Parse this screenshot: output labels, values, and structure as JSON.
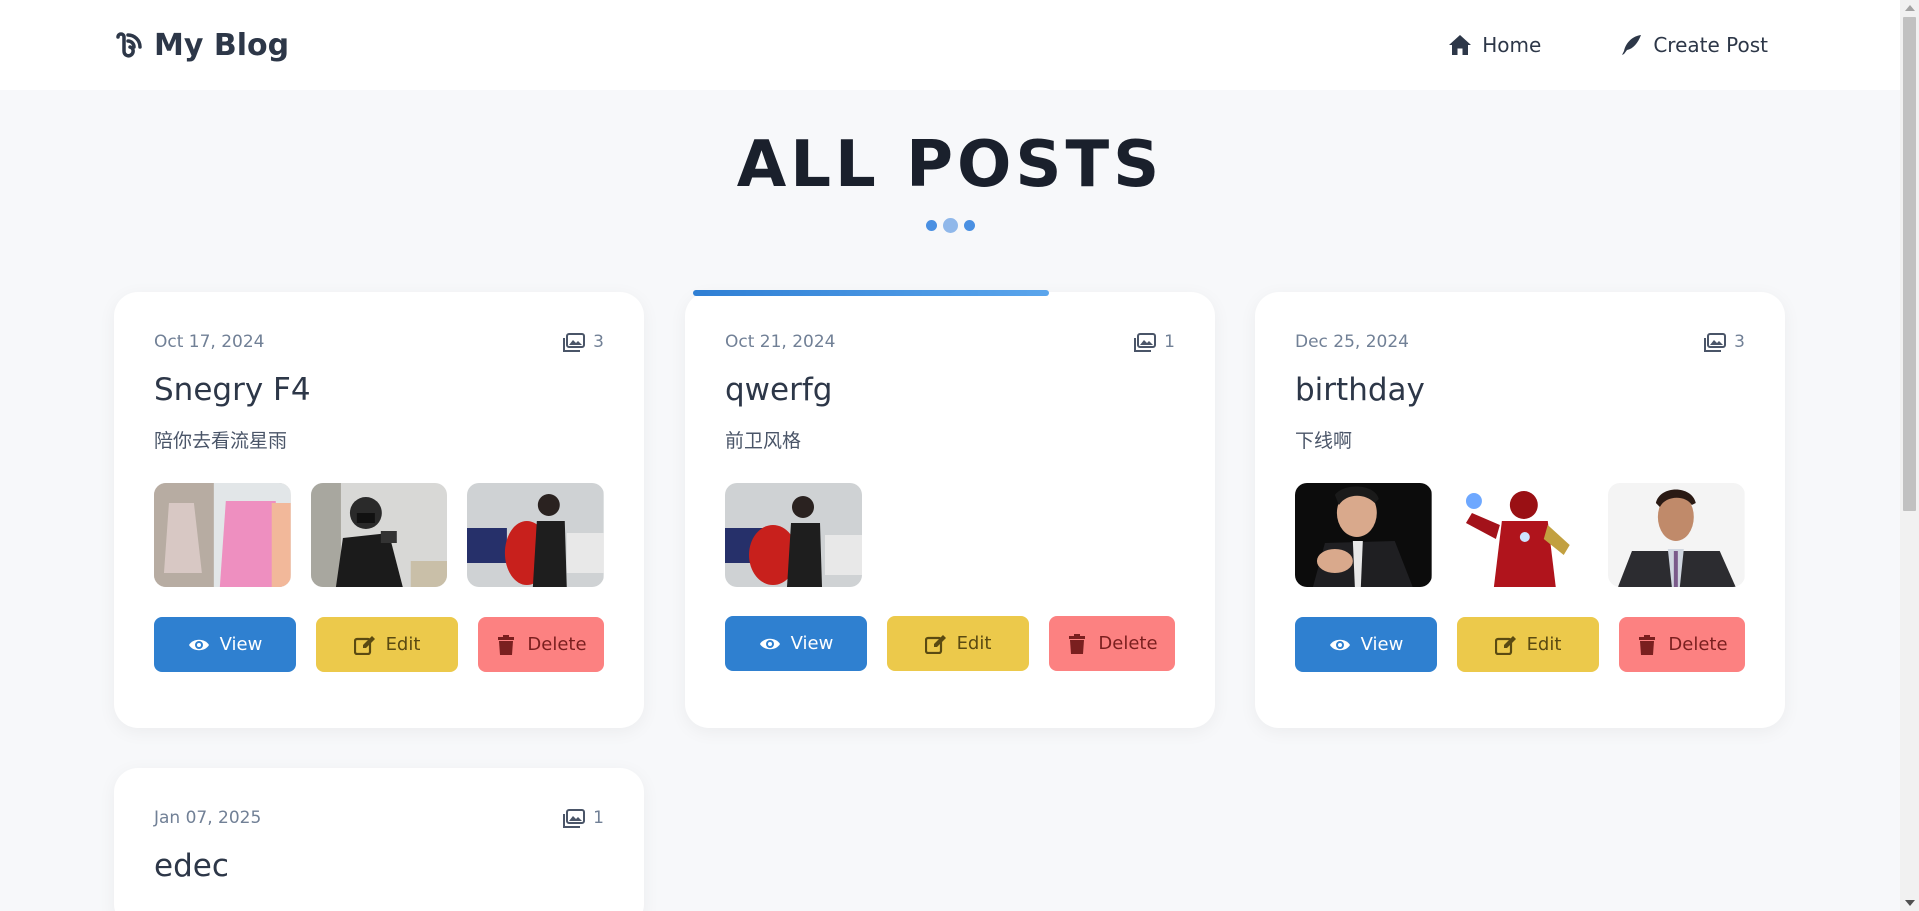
{
  "brand": {
    "title": "My Blog",
    "icon": "feed-icon"
  },
  "nav": {
    "home_label": "Home",
    "create_label": "Create Post"
  },
  "page": {
    "title": "ALL POSTS"
  },
  "posts": [
    {
      "date": "Oct 17, 2024",
      "image_count": "3",
      "title": "Snegry F4",
      "description": "陪你去看流星雨",
      "view_label": "View",
      "edit_label": "Edit",
      "delete_label": "Delete"
    },
    {
      "date": "Oct 21, 2024",
      "image_count": "1",
      "title": "qwerfg",
      "description": "前卫风格",
      "view_label": "View",
      "edit_label": "Edit",
      "delete_label": "Delete"
    },
    {
      "date": "Dec 25, 2024",
      "image_count": "3",
      "title": "birthday",
      "description": "下线啊",
      "view_label": "View",
      "edit_label": "Edit",
      "delete_label": "Delete"
    },
    {
      "date": "Jan 07, 2025",
      "image_count": "1",
      "title": "edec"
    }
  ],
  "colors": {
    "accent": "#2f80d0",
    "edit": "#ecc94b",
    "delete": "#fc8181",
    "background": "#f7f8fa"
  }
}
